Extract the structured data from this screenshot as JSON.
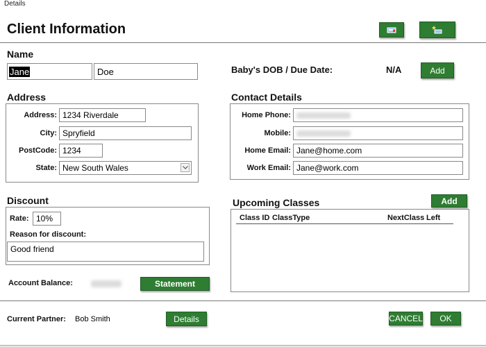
{
  "window": {
    "title": "Details"
  },
  "header": {
    "title": "Client Information"
  },
  "name": {
    "heading": "Name",
    "first": "Jane",
    "last": "Doe"
  },
  "baby": {
    "label": "Baby's DOB / Due Date:",
    "value": "N/A",
    "add_label": "Add"
  },
  "address": {
    "heading": "Address",
    "address_label": "Address:",
    "address_value": "1234 Riverdale",
    "city_label": "City:",
    "city_value": "Spryfield",
    "postcode_label": "PostCode:",
    "postcode_value": "1234",
    "state_label": "State:",
    "state_value": "New South Wales"
  },
  "contact": {
    "heading": "Contact Details",
    "home_phone_label": "Home Phone:",
    "mobile_label": "Mobile:",
    "home_email_label": "Home Email:",
    "home_email_value": "Jane@home.com",
    "work_email_label": "Work Email:",
    "work_email_value": "Jane@work.com"
  },
  "discount": {
    "heading": "Discount",
    "rate_label": "Rate:",
    "rate_value": "10%",
    "reason_label": "Reason for discount:",
    "reason_value": "Good friend"
  },
  "classes": {
    "heading": "Upcoming Classes",
    "add_label": "Add",
    "columns": [
      "Class ID",
      "ClassType",
      "NextClass",
      "Left"
    ]
  },
  "account": {
    "balance_label": "Account Balance:",
    "statement_label": "Statement"
  },
  "partner": {
    "label": "Current Partner:",
    "value": "Bob Smith",
    "details_label": "Details"
  },
  "actions": {
    "cancel_label": "CANCEL",
    "ok_label": "OK"
  },
  "colors": {
    "button_green": "#2e7d32",
    "border_gray": "#888888"
  },
  "icons": {
    "toolbar_1": "save-icon",
    "toolbar_2": "new-icon"
  }
}
